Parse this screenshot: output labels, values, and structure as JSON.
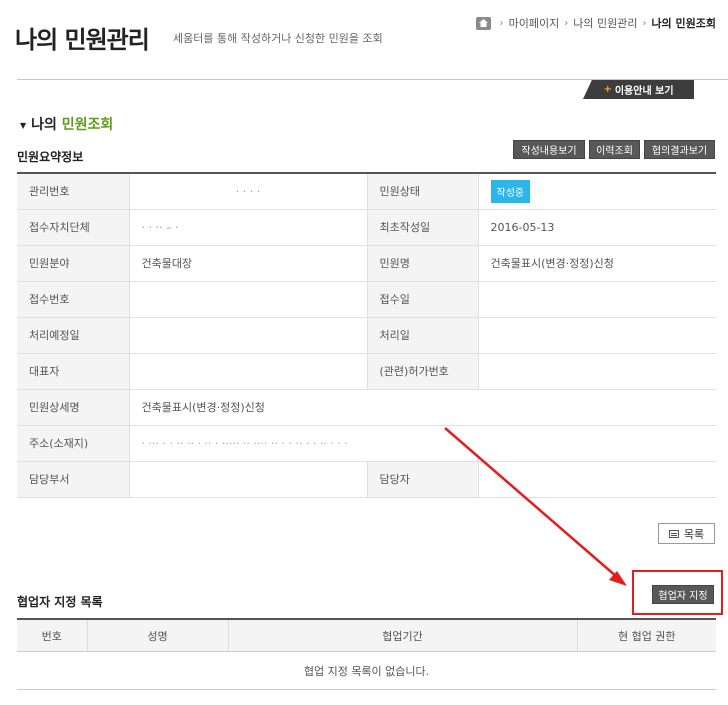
{
  "header": {
    "title": "나의 민원관리",
    "subtitle": "세움터를 통해 작성하거나 신청한 민원을 조회"
  },
  "breadcrumb": {
    "items": [
      "마이페이지",
      "나의 민원관리"
    ],
    "current": "나의 민원조회",
    "separator": "›"
  },
  "guide_button": {
    "plus": "+",
    "label": "이용안내 보기"
  },
  "section": {
    "heading_prefix": "나의 ",
    "heading_highlight": "민원조회"
  },
  "summary": {
    "heading": "민원요약정보",
    "buttons": [
      "작성내용보기",
      "이력조회",
      "협의결과보기"
    ]
  },
  "info_rows": [
    {
      "label1": "관리번호",
      "value1": "· · · ·",
      "label2": "민원상태",
      "value2": "작성중"
    },
    {
      "label1": "접수자치단체",
      "value1": "·  · ·· – ·",
      "label2": "최초작성일",
      "value2": "2016-05-13"
    },
    {
      "label1": "민원분야",
      "value1": "건축물대장",
      "label2": "민원명",
      "value2": "건축물표시(변경·정정)신청"
    },
    {
      "label1": "접수번호",
      "value1": "",
      "label2": "접수일",
      "value2": ""
    },
    {
      "label1": "처리예정일",
      "value1": "",
      "label2": "처리일",
      "value2": ""
    },
    {
      "label1": "대표자",
      "value1": "",
      "label2": "(관련)허가번호",
      "value2": ""
    },
    {
      "label1": "민원상세명",
      "value1": "건축물표시(변경·정정)신청"
    },
    {
      "label1": "주소(소재지)",
      "value1": "·  ··· · · ·· ·· · ·· · ·····  ·· ···· ·· · · ·· ·  · ··  · · ·"
    },
    {
      "label1": "담당부서",
      "value1": "",
      "label2": "담당자",
      "value2": ""
    }
  ],
  "list_button": {
    "label": "목록"
  },
  "coop": {
    "heading": "협업자 지정 목록",
    "assign_button": "협업자 지정",
    "columns": [
      "번호",
      "성명",
      "협업기간",
      "현 협업 권한"
    ],
    "empty_message": "협업 지정 목록이 없습니다."
  },
  "colors": {
    "accent_green": "#5e9c19",
    "status_blue": "#2ab6e8",
    "annotation_red": "#e41e1e",
    "button_dark": "#585858"
  }
}
